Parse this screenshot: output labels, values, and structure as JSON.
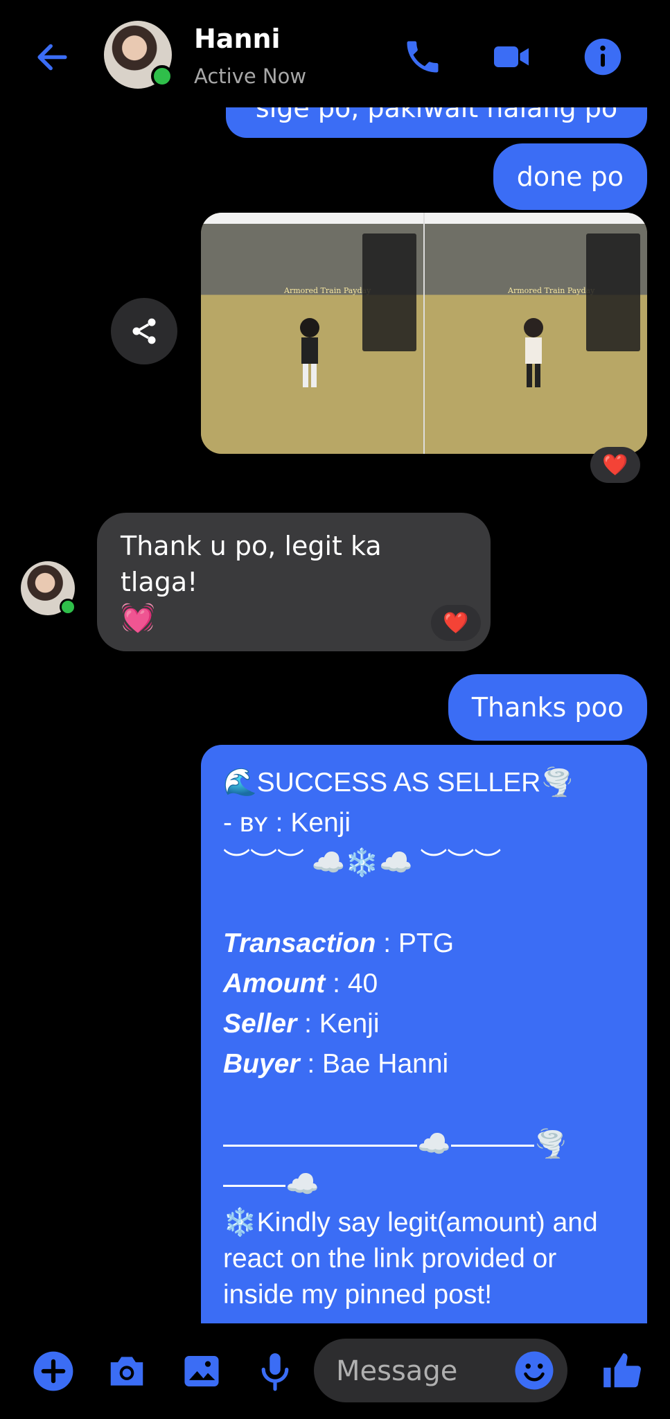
{
  "header": {
    "contact_name": "Hanni",
    "status": "Active Now"
  },
  "messages": {
    "partial_out": "sige po, pakiwait nalang po",
    "done": "done po",
    "thank_in": "Thank u po, legit ka tlaga!",
    "thanks_out": "Thanks poo",
    "reaction": "❤️"
  },
  "photo": {
    "left_label": "Armored Train Payday",
    "right_label": "Armored Train Payday"
  },
  "card": {
    "title": "SUCCESS AS SELLER",
    "by_prefix": "- ʙʏ : ",
    "by_name": "Kenji",
    "divider": "︶︶︶ ☁️❄️☁️ ︶︶︶",
    "transaction_label": "Transaction",
    "transaction_value": " : PTG",
    "amount_label": "Amount",
    "amount_value": " : 40",
    "seller_label": "Seller",
    "seller_value": " : Kenji",
    "buyer_label": "Buyer",
    "buyer_value": " : Bae Hanni",
    "note": "Kindly say legit(amount) and react on the link provided or inside my pinned post!"
  },
  "composer": {
    "placeholder": "Message"
  },
  "colors": {
    "accent": "#3b6df5",
    "bubble_in": "#3a3a3c",
    "online": "#2fbf4a"
  }
}
